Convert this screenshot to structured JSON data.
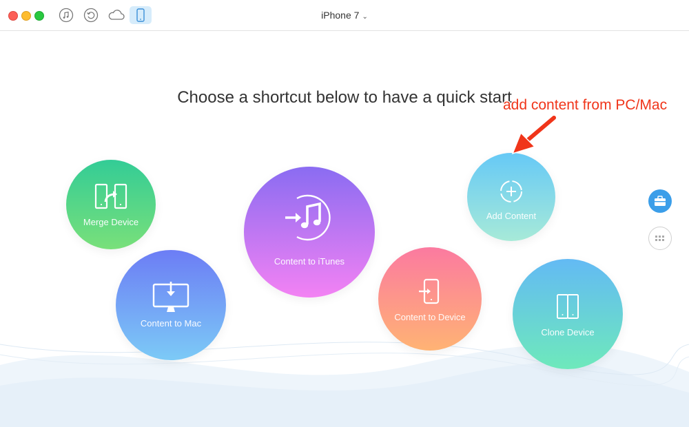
{
  "window": {
    "device_name": "iPhone 7"
  },
  "toolbar": {
    "icons": [
      "music-icon",
      "restore-icon",
      "cloud-icon",
      "phone-icon"
    ],
    "active": "phone-icon"
  },
  "main": {
    "headline": "Choose a shortcut below to have a quick start",
    "annotation": "add content from PC/Mac",
    "shortcuts": [
      {
        "label": "Merge Device",
        "icon": "merge-device-icon"
      },
      {
        "label": "Content to Mac",
        "icon": "content-to-mac-icon"
      },
      {
        "label": "Content to iTunes",
        "icon": "content-to-itunes-icon"
      },
      {
        "label": "Content to Device",
        "icon": "content-to-device-icon"
      },
      {
        "label": "Add Content",
        "icon": "add-content-icon"
      },
      {
        "label": "Clone Device",
        "icon": "clone-device-icon"
      }
    ]
  },
  "side": {
    "buttons": [
      "toolbox-icon",
      "grid-icon"
    ]
  },
  "colors": {
    "annotation": "#f0351a",
    "active_tool_bg": "#d6ecfb",
    "side_accent": "#3b9ee9"
  }
}
